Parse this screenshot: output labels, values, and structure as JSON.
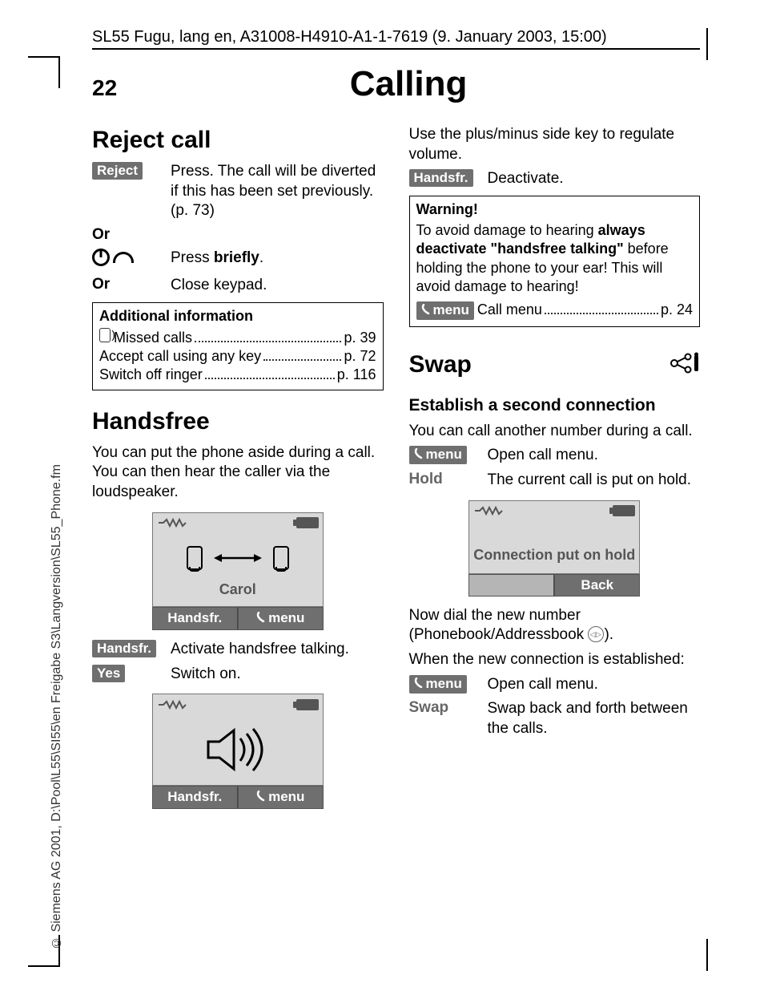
{
  "copyright": "© Siemens AG 2001, D:\\Pool\\L55\\SI55\\en Freigabe S3\\Langversion\\SL55_Phone.fm",
  "docHeader": "SL55 Fugu, lang en, A31008-H4910-A1-1-7619 (9. January 2003, 15:00)",
  "pageNumber": "22",
  "pageTitle": "Calling",
  "left": {
    "rejectHeading": "Reject call",
    "rejectLabel": "Reject",
    "rejectText": "Press. The call will be diverted if this has been set previously.(p. 73)",
    "or1": "Or",
    "pressBriefly_pre": "Press ",
    "pressBriefly_bold": "briefly",
    "pressBriefly_post": ".",
    "or2": "Or",
    "closeKeypad": "Close keypad.",
    "addInfoTitle": "Additional information",
    "rows": [
      {
        "icon": true,
        "label": "Missed calls",
        "page": "p. 39"
      },
      {
        "icon": false,
        "label": "Accept call using any key",
        "page": "p. 72"
      },
      {
        "icon": false,
        "label": "Switch off ringer",
        "page": "p. 116"
      }
    ],
    "handsfreeHeading": "Handsfree",
    "handsfreeIntro": "You can put the phone aside during a call. You can then hear the caller via the loudspeaker.",
    "screen1_name": "Carol",
    "softLeft": "Handsfr.",
    "softRight": "menu",
    "handsfrLabel": "Handsfr.",
    "handsfrText": "Activate handsfree talking.",
    "yesLabel": "Yes",
    "yesText": "Switch on."
  },
  "right": {
    "volumeText": "Use the plus/minus side key to regulate volume.",
    "handsfrLabel2": "Handsfr.",
    "deactivate": "Deactivate.",
    "warnTitle": "Warning!",
    "warn_a": "To avoid damage to hearing ",
    "warn_b": "always deactivate \"handsfree talking\"",
    "warn_c": " before holding the phone to your ear! This will avoid damage to hearing!",
    "warnMenuLabel": "menu",
    "warnMenuText": "Call menu",
    "warnMenuPage": "p. 24",
    "swapHeading": "Swap",
    "establishHeading": "Establish a second connection",
    "establishIntro": "You can call another number during a call.",
    "menuLabel": "menu",
    "openCallMenu": "Open call menu.",
    "holdLabel": "Hold",
    "holdText": "The current call is put on hold.",
    "screen2_text": "Connection put on hold",
    "screen2_back": "Back",
    "dialText": "Now dial the new number (Phonebook/Addressbook ",
    "dialText2": ").",
    "whenEstablished": "When the new connection is established:",
    "menuLabel2": "menu",
    "openCallMenu2": "Open call menu.",
    "swapLabel": "Swap",
    "swapText": "Swap back and forth between the calls."
  }
}
